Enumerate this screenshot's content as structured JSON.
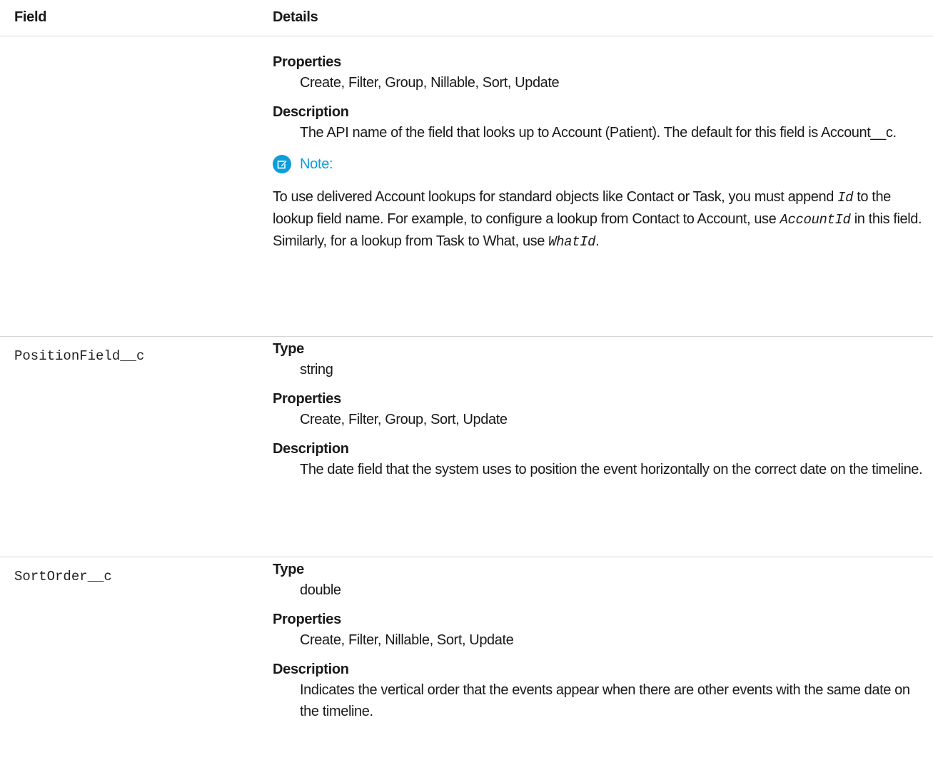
{
  "table": {
    "headers": {
      "field": "Field",
      "details": "Details"
    }
  },
  "row0": {
    "properties_label": "Properties",
    "properties": "Create, Filter, Group, Nillable, Sort, Update",
    "description_label": "Description",
    "description": "The API name of the field that looks up to Account (Patient). The default for this field is Account__c.",
    "note": {
      "label": "Note:",
      "text_1": "To use delivered Account lookups for standard objects like Contact or Task, you must append ",
      "code_1": "Id",
      "text_2": " to the lookup field name. For example, to configure a lookup from Contact to Account, use ",
      "code_2": "AccountId",
      "text_3": " in this field. Similarly, for a lookup from Task to What, use ",
      "code_3": "WhatId",
      "text_4": "."
    }
  },
  "row1": {
    "field_name": "PositionField__c",
    "type_label": "Type",
    "type": "string",
    "properties_label": "Properties",
    "properties": "Create, Filter, Group, Sort, Update",
    "description_label": "Description",
    "description": "The date field that the system uses to position the event horizontally on the correct date on the timeline."
  },
  "row2": {
    "field_name": "SortOrder__c",
    "type_label": "Type",
    "type": "double",
    "properties_label": "Properties",
    "properties": "Create, Filter, Nillable, Sort, Update",
    "description_label": "Description",
    "description": "Indicates the vertical order that the events appear when there are other events with the same date on the timeline."
  },
  "colors": {
    "note_accent": "#0d9dda",
    "divider": "#d5d5d5"
  },
  "icons": {
    "note": "edit-pencil-icon"
  }
}
